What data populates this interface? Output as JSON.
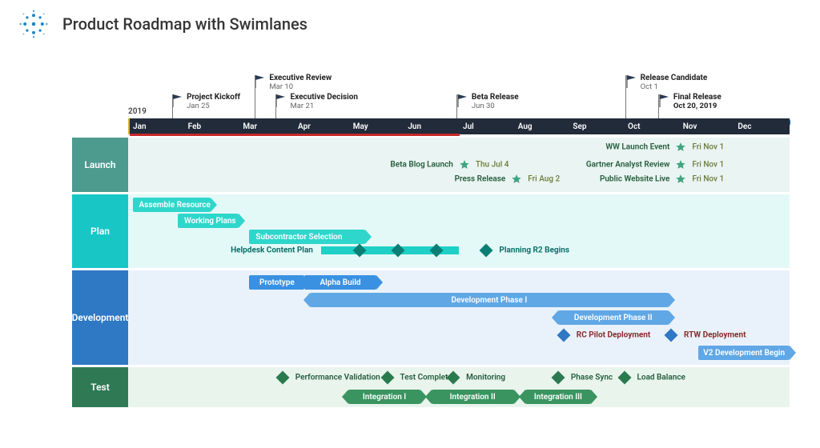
{
  "title": "Product Roadmap with Swimlanes",
  "year_label_left": "2019",
  "year_label_right": "2019",
  "colors": {
    "launch_lane": "#4d9a8f",
    "plan_lane": "#18c6c6",
    "development_lane": "#2f78c4",
    "test_lane": "#2f7a55",
    "timeline_bg": "#212b39",
    "timeline_highlight": "#c62828",
    "star": "#3fa580",
    "diamond_teal": "#0b7f76",
    "diamond_blue": "#2f78c4",
    "diamond_green": "#2a7a4f"
  },
  "months": [
    "Jan",
    "Feb",
    "Mar",
    "Apr",
    "May",
    "Jun",
    "Jul",
    "Aug",
    "Sep",
    "Oct",
    "Nov",
    "Dec"
  ],
  "flags": [
    {
      "label": "Project Kickoff",
      "date": "Jan 25",
      "month_pos": 0.8,
      "row": 1
    },
    {
      "label": "Executive Review",
      "date": "Mar 10",
      "month_pos": 2.3,
      "row": 0
    },
    {
      "label": "Executive Decision",
      "date": "Mar 21",
      "month_pos": 2.68,
      "row": 1
    },
    {
      "label": "Beta Release",
      "date": "Jun 30",
      "month_pos": 5.97,
      "row": 1
    },
    {
      "label": "Release Candidate",
      "date": "Oct 1",
      "month_pos": 9.03,
      "row": 0
    },
    {
      "label": "Final Release",
      "date": "Oct 20, 2019",
      "month_pos": 9.63,
      "row": 1,
      "bold_date": true
    }
  ],
  "lanes": {
    "launch": {
      "label": "Launch",
      "events": [
        {
          "label": "Beta Blog Launch",
          "date": "Thu Jul 4",
          "month_pos": 6.1,
          "row": 0
        },
        {
          "label": "Press Release",
          "date": "Fri Aug 2",
          "month_pos": 7.05,
          "row": 1
        },
        {
          "label": "WW Launch Event",
          "date": "Fri Nov 1",
          "month_pos": 10.03,
          "row": -1
        },
        {
          "label": "Gartner Analyst Review",
          "date": "Fri Nov 1",
          "month_pos": 10.03,
          "row": 0
        },
        {
          "label": "Public Website Live",
          "date": "Fri Nov 1",
          "month_pos": 10.03,
          "row": 1
        }
      ]
    },
    "plan": {
      "label": "Plan",
      "bars": [
        {
          "label": "Assemble Resources",
          "start": 0.08,
          "end": 1.5,
          "row": 0
        },
        {
          "label": "Working Plans",
          "start": 0.9,
          "end": 2.0,
          "row": 1
        },
        {
          "label": "Subcontractor Selection",
          "start": 2.2,
          "end": 4.3,
          "row": 2
        }
      ],
      "helpdesk": {
        "label": "Helpdesk Content Plan",
        "start": 3.5,
        "end": 6.0,
        "row": 3,
        "diamonds": [
          4.2,
          4.9,
          5.6
        ]
      },
      "planning_r2": {
        "label": "Planning R2 Begins",
        "month_pos": 6.5,
        "row": 3
      }
    },
    "development": {
      "label": "Development",
      "bars": [
        {
          "label": "Prototype",
          "start": 2.2,
          "end": 3.2,
          "row": 0
        },
        {
          "label": "Alpha Build",
          "start": 3.2,
          "end": 4.5,
          "row": 0,
          "arrow": "right"
        },
        {
          "label": "Development Phase I",
          "start": 3.3,
          "end": 9.8,
          "row": 1,
          "arrow": "both",
          "light": true
        },
        {
          "label": "Development Phase II",
          "start": 7.8,
          "end": 9.8,
          "row": 2,
          "arrow": "both",
          "light": true
        },
        {
          "label": "V2 Development Begin",
          "start": 10.35,
          "end": 12.0,
          "row": 4,
          "arrow": "right",
          "light": true
        }
      ],
      "diamonds": [
        {
          "label": "RC Pilot Deployment",
          "month_pos": 7.9,
          "row": 3
        },
        {
          "label": "RTW Deployment",
          "month_pos": 9.85,
          "row": 3
        }
      ]
    },
    "test": {
      "label": "Test",
      "diamonds": [
        {
          "label": "Performance Validation",
          "month_pos": 2.8,
          "row": 0
        },
        {
          "label": "Test Complete",
          "month_pos": 4.7,
          "row": 0
        },
        {
          "label": "Monitoring",
          "month_pos": 5.9,
          "row": 0
        },
        {
          "label": "Phase Sync",
          "month_pos": 7.8,
          "row": 0
        },
        {
          "label": "Load Balance",
          "month_pos": 9.0,
          "row": 0
        }
      ],
      "bars": [
        {
          "label": "Integration I",
          "start": 4.0,
          "end": 5.3,
          "row": 1,
          "arrow": "both"
        },
        {
          "label": "Integration II",
          "start": 5.5,
          "end": 7.0,
          "row": 1,
          "arrow": "both"
        },
        {
          "label": "Integration III",
          "start": 7.2,
          "end": 8.4,
          "row": 1,
          "arrow": "both"
        }
      ]
    }
  }
}
